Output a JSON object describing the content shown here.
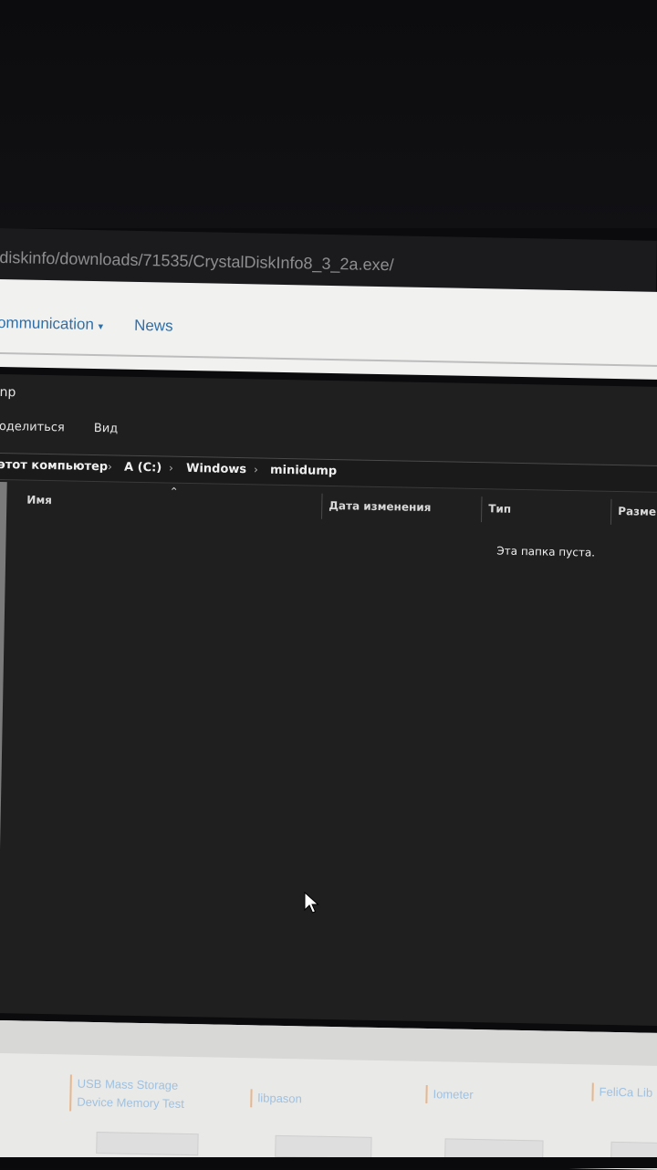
{
  "browser": {
    "url": "diskinfo/downloads/71535/CrystalDiskInfo8_3_2a.exe/"
  },
  "site_nav": {
    "items": [
      {
        "label": "ommunication",
        "has_dropdown": true
      },
      {
        "label": "News",
        "has_dropdown": false
      }
    ]
  },
  "explorer": {
    "title": "np",
    "ribbon": [
      "оделиться",
      "Вид"
    ],
    "breadcrumb": [
      "этот компьютер",
      "A (C:)",
      "Windows",
      "minidump"
    ],
    "columns": [
      "Имя",
      "Дата изменения",
      "Тип",
      "Разме"
    ],
    "empty_message": "Эта папка пуста."
  },
  "products": [
    {
      "label": "USB Mass Storage\nDevice Memory Test"
    },
    {
      "label": "libpason"
    },
    {
      "label": "Iometer"
    },
    {
      "label": "FeliCa Lib"
    }
  ],
  "colors": {
    "link": "#2f6fa8",
    "explorer_bg": "#1f1f1f",
    "product_link": "#9fc1e0"
  }
}
